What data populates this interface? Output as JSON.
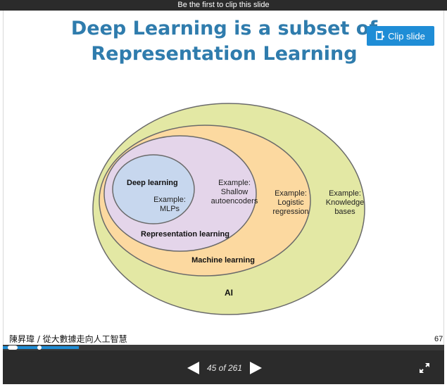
{
  "topbar": {
    "text": "Be the first to clip this slide"
  },
  "slide": {
    "title_line1": "Deep Learning is a subset of",
    "title_line2": "Representation Learning",
    "clip_button_label": "Clip slide",
    "footer_author": "陳昇瑋 / 從大數據走向人工智慧",
    "page_number": "67"
  },
  "diagram": {
    "ellipses": [
      {
        "label": "AI",
        "example": "Example:\nKnowledge\nbases",
        "color": "#e3e8a4"
      },
      {
        "label": "Machine learning",
        "example": "Example:\nLogistic\nregression",
        "color": "#fcd9a0"
      },
      {
        "label": "Representation learning",
        "example": "Example:\nShallow\nautoencoders",
        "color": "#e4d5ea"
      },
      {
        "label": "Deep learning",
        "example": "Example:\nMLPs",
        "color": "#c7d7ee"
      }
    ]
  },
  "player": {
    "counter": "45 of 261",
    "progress_fraction": 0.172
  }
}
